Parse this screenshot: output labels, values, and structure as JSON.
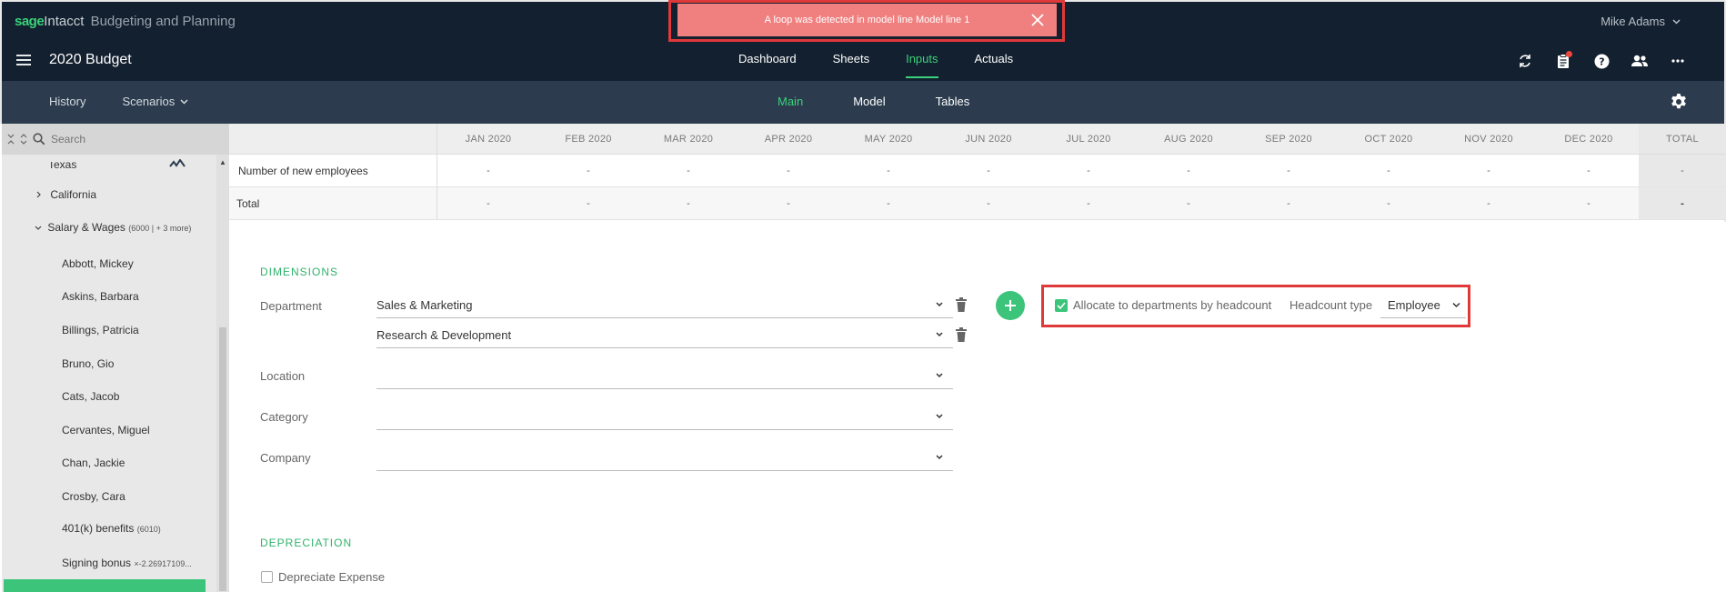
{
  "header": {
    "brand_sage": "sage",
    "brand_intacct": "Intacct",
    "brand_product": "Budgeting and Planning",
    "user_name": "Mike Adams",
    "budget_title": "2020 Budget",
    "nav": [
      "Dashboard",
      "Sheets",
      "Inputs",
      "Actuals"
    ],
    "active_nav": "Inputs"
  },
  "toast": {
    "message": "A loop was detected in model line Model line 1"
  },
  "subnav": {
    "history": "History",
    "scenarios": "Scenarios",
    "tabs": [
      "Main",
      "Model",
      "Tables"
    ],
    "active_tab": "Main"
  },
  "sidebar": {
    "search_placeholder": "Search",
    "items": [
      {
        "label": "Texas"
      },
      {
        "label": "California"
      },
      {
        "label": "Salary & Wages",
        "code": "(6000 | + 3 more)"
      },
      {
        "label": "Abbott, Mickey"
      },
      {
        "label": "Askins, Barbara"
      },
      {
        "label": "Billings, Patricia"
      },
      {
        "label": "Bruno, Gio"
      },
      {
        "label": "Cats, Jacob"
      },
      {
        "label": "Cervantes, Miguel"
      },
      {
        "label": "Chan, Jackie"
      },
      {
        "label": "Crosby, Cara"
      },
      {
        "label": "401(k) benefits",
        "code": "(6010)"
      },
      {
        "label": "Signing bonus",
        "code": "×-2.26917109..."
      }
    ]
  },
  "grid": {
    "months": [
      "JAN 2020",
      "FEB 2020",
      "MAR 2020",
      "APR 2020",
      "MAY 2020",
      "JUN 2020",
      "JUL 2020",
      "AUG 2020",
      "SEP 2020",
      "OCT 2020",
      "NOV 2020",
      "DEC 2020"
    ],
    "total_header": "TOTAL",
    "rows": [
      {
        "label": "Number of new employees",
        "cells": [
          "-",
          "-",
          "-",
          "-",
          "-",
          "-",
          "-",
          "-",
          "-",
          "-",
          "-",
          "-"
        ],
        "total": "-"
      },
      {
        "label": "Total",
        "cells": [
          "-",
          "-",
          "-",
          "-",
          "-",
          "-",
          "-",
          "-",
          "-",
          "-",
          "-",
          "-"
        ],
        "total": "-"
      }
    ]
  },
  "dimensions": {
    "title": "DIMENSIONS",
    "department_label": "Department",
    "department_values": [
      "Sales & Marketing",
      "Research & Development"
    ],
    "location_label": "Location",
    "category_label": "Category",
    "company_label": "Company",
    "allocate_label": "Allocate to departments by headcount",
    "headcount_type_label": "Headcount type",
    "headcount_type_value": "Employee"
  },
  "depreciation": {
    "title": "DEPRECIATION",
    "depreciate_label": "Depreciate Expense"
  }
}
